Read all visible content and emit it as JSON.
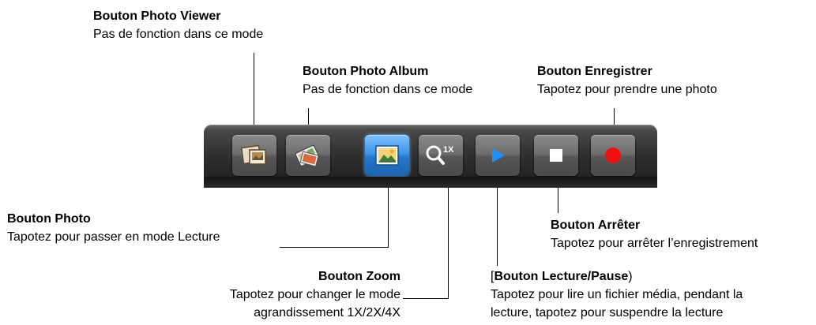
{
  "callouts": {
    "photo_viewer": {
      "title": "Bouton Photo Viewer",
      "desc": "Pas de fonction dans ce mode"
    },
    "photo_album": {
      "title": "Bouton Photo Album",
      "desc": "Pas de fonction dans ce mode"
    },
    "record": {
      "title": "Bouton Enregistrer",
      "desc": "Tapotez pour prendre une photo"
    },
    "photo": {
      "title": "Bouton Photo",
      "desc": "Tapotez pour passer en mode Lecture"
    },
    "stop": {
      "title": "Bouton Arrêter",
      "desc": "Tapotez pour arrêter l’enregistrement"
    },
    "zoom": {
      "title": "Bouton Zoom",
      "desc_line1": "Tapotez pour changer le mode",
      "desc_line2": "agrandissement 1X/2X/4X"
    },
    "play_pause": {
      "open_bracket": "[",
      "title": "Bouton Lecture/Pause",
      "close_paren": ")",
      "desc_line1": "Tapotez pour lire un fichier média, pendant la",
      "desc_line2": "lecture, tapotez pour suspendre la lecture"
    }
  },
  "toolbar": {
    "buttons": [
      {
        "name": "photo-viewer-button",
        "icon": "photo-viewer-icon"
      },
      {
        "name": "photo-album-button",
        "icon": "photo-album-icon"
      },
      {
        "name": "photo-button",
        "icon": "photo-icon",
        "active": true
      },
      {
        "name": "zoom-button",
        "icon": "zoom-icon",
        "zoom_label": "1X"
      },
      {
        "name": "play-pause-button",
        "icon": "play-icon"
      },
      {
        "name": "stop-button",
        "icon": "stop-icon"
      },
      {
        "name": "record-button",
        "icon": "record-icon"
      }
    ]
  },
  "colors": {
    "active_button": "#2f86dd",
    "play": "#1e90ff",
    "record": "#ee1111",
    "toolbar": "#2c2c2c"
  }
}
